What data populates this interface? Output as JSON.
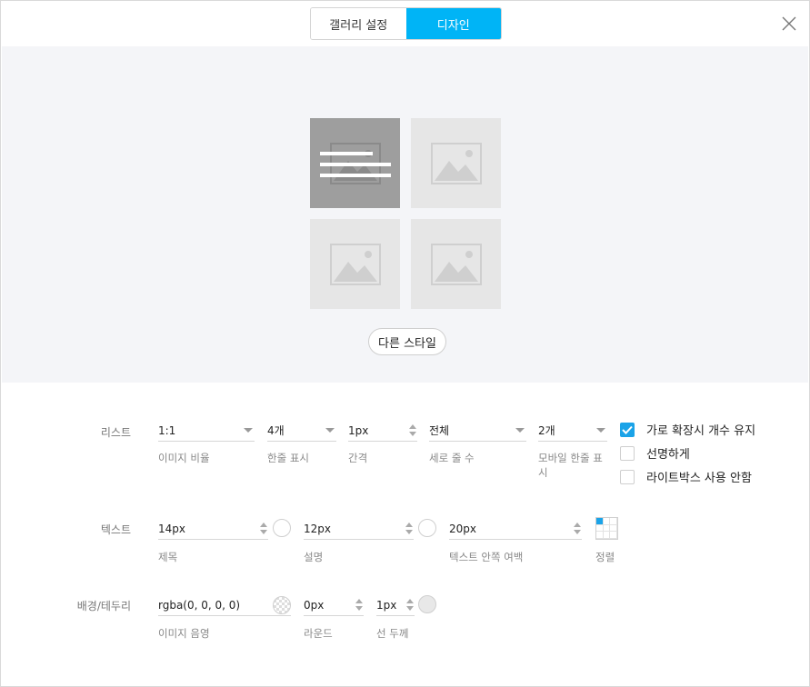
{
  "header": {
    "tabs": [
      {
        "label": "갤러리 설정",
        "active": false
      },
      {
        "label": "디자인",
        "active": true
      }
    ],
    "close_icon": "close-icon",
    "accent_color": "#00b4f6"
  },
  "preview": {
    "tile_icon": "image-placeholder-icon",
    "other_style_label": "다른 스타일"
  },
  "settings": {
    "list": {
      "label": "리스트",
      "image_ratio": {
        "value": "1:1",
        "caption": "이미지 비율"
      },
      "per_row": {
        "value": "4개",
        "caption": "한줄 표시"
      },
      "gap": {
        "value": "1px",
        "caption": "간격"
      },
      "rows": {
        "value": "전체",
        "caption": "세로 줄 수"
      },
      "mobile_per_row": {
        "value": "2개",
        "caption": "모바일 한줄 표시"
      }
    },
    "text": {
      "label": "텍스트",
      "title_size": {
        "value": "14px",
        "caption": "제목"
      },
      "desc_size": {
        "value": "12px",
        "caption": "설명"
      },
      "padding": {
        "value": "20px",
        "caption": "텍스트 안쪽 여백"
      },
      "align_caption": "정렬"
    },
    "border": {
      "label": "배경/테두리",
      "shadow": {
        "value": "rgba(0, 0, 0, 0)",
        "caption": "이미지 음영"
      },
      "radius": {
        "value": "0px",
        "caption": "라운드"
      },
      "width": {
        "value": "1px",
        "caption": "선 두께"
      }
    },
    "options": [
      {
        "label": "가로 확장시 개수 유지",
        "checked": true
      },
      {
        "label": "선명하게",
        "checked": false
      },
      {
        "label": "라이트박스 사용 안함",
        "checked": false
      }
    ]
  }
}
